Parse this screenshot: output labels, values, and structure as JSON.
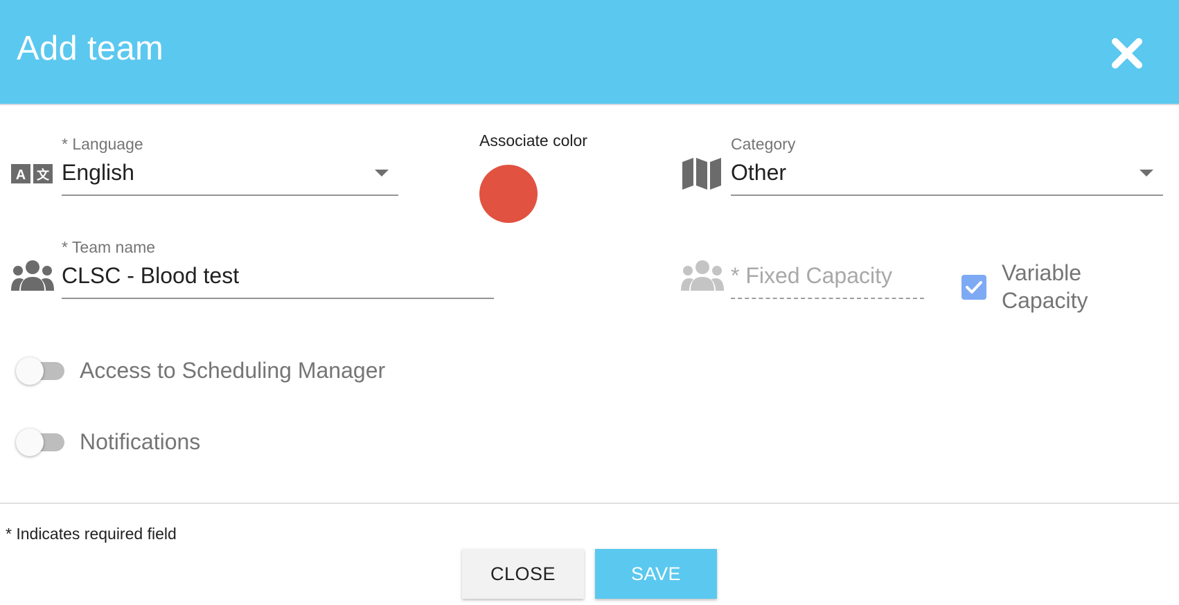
{
  "dialog": {
    "title": "Add team",
    "close_icon": "close-icon"
  },
  "language": {
    "label": "* Language",
    "value": "English",
    "icon": "translate-icon"
  },
  "color": {
    "label": "Associate color",
    "value": "#e15241"
  },
  "category": {
    "label": "Category",
    "value": "Other",
    "icon": "map-icon"
  },
  "team_name": {
    "label": "* Team name",
    "value": "CLSC - Blood test",
    "icon": "group-icon"
  },
  "fixed_capacity": {
    "placeholder": "* Fixed Capacity",
    "disabled": true,
    "icon": "group-icon"
  },
  "variable_capacity": {
    "label_line1": "Variable",
    "label_line2": "Capacity",
    "checked": true
  },
  "toggles": [
    {
      "label": "Access to Scheduling Manager",
      "on": false
    },
    {
      "label": "Notifications",
      "on": false
    }
  ],
  "footer": {
    "required_note": "* Indicates required field",
    "close_label": "CLOSE",
    "save_label": "SAVE"
  },
  "colors": {
    "accent": "#5bc8ef",
    "checkbox": "#7eaaf4",
    "swatch": "#e15241"
  }
}
